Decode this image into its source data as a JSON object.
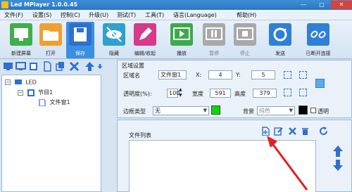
{
  "window": {
    "title": "Led MPlayer 1.0.0.45",
    "min": "—",
    "max": "□",
    "close": "✕"
  },
  "menu": [
    "文件(F)",
    "设置(S)",
    "控制(C)",
    "升级(U)",
    "测试(T)",
    "工具(T)",
    "语言(Language)",
    "帮助(H)"
  ],
  "toolbar": [
    {
      "label": "新建屏幕",
      "icon": "new-screen-icon",
      "color": "#3db04a"
    },
    {
      "label": "打开",
      "icon": "open-folder-icon",
      "color": "#f0a030"
    },
    {
      "label": "保存",
      "icon": "save-icon",
      "color": "#2f6fd0"
    },
    {
      "label": "隐藏",
      "icon": "hide-eye-icon",
      "color": "#2fa0d0"
    },
    {
      "label": "编辑/收起",
      "icon": "edit-pencil-icon",
      "color": "#d63a8a"
    },
    {
      "label": "播放",
      "icon": "play-icon",
      "color": "#3caa4a"
    },
    {
      "label": "暂停",
      "icon": "pause-icon",
      "color": "#a8a8a8"
    },
    {
      "label": "停止",
      "icon": "stop-icon",
      "color": "#a8a8a8"
    },
    {
      "label": "发送",
      "icon": "send-refresh-icon",
      "color": "#2f7fd8"
    },
    {
      "label": "已断开连接",
      "icon": "disconnected-link-icon",
      "color": "#2f7fd8"
    }
  ],
  "tree": {
    "root": "LED",
    "program": "节目1",
    "window": "文件窗1",
    "expand_minus": "−"
  },
  "region": {
    "header": "区域设置",
    "name_label": "区域名",
    "name_value": "文件窗1",
    "x_label": "X:",
    "x_value": "4",
    "y_label": "Y:",
    "y_value": "5",
    "opacity_label": "透明度(%):",
    "opacity_value": "100",
    "width_label": "宽度",
    "width_value": "591",
    "height_label": "高度",
    "height_value": "379",
    "border_label": "边框类型",
    "border_value": "无",
    "background_label": "背景",
    "background_value": "纯色",
    "transparent_label": "透明",
    "border_color": "#00e000",
    "bg_color": "#000000"
  },
  "file_list": {
    "header": "文件列表"
  },
  "colors": {
    "accent_blue": "#3a8fe0",
    "highlight_arrow": "#e02020"
  }
}
